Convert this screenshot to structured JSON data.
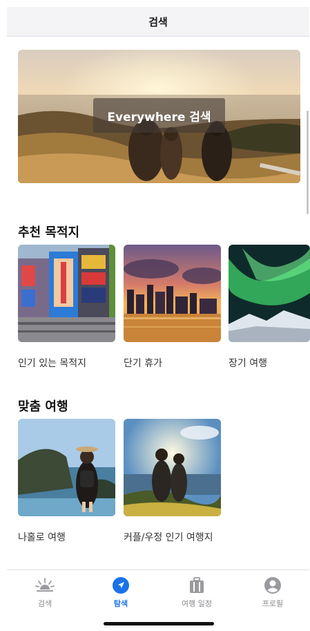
{
  "header": {
    "title": "검색"
  },
  "hero": {
    "label": "Everywhere 검색"
  },
  "recommended": {
    "title": "추천 목적지",
    "cards": [
      {
        "label": "인기 있는 목적지",
        "icon": "city-billboards-image"
      },
      {
        "label": "단기 휴가",
        "icon": "city-skyline-image"
      },
      {
        "label": "장기 여행",
        "icon": "aurora-image"
      }
    ]
  },
  "custom": {
    "title": "맞춤 여행",
    "cards": [
      {
        "label": "나홀로 여행",
        "icon": "solo-traveler-image"
      },
      {
        "label": "커플/우정 인기 여행지",
        "icon": "couple-sunset-image"
      }
    ]
  },
  "tabs": [
    {
      "label": "검색",
      "icon": "sunrise-icon",
      "active": false
    },
    {
      "label": "탐색",
      "icon": "compass-arrow-icon",
      "active": true
    },
    {
      "label": "여행 일정",
      "icon": "suitcase-icon",
      "active": false
    },
    {
      "label": "프로필",
      "icon": "person-icon",
      "active": false
    }
  ],
  "colors": {
    "accent": "#1a73e8",
    "inactive": "#8a8a8e"
  }
}
